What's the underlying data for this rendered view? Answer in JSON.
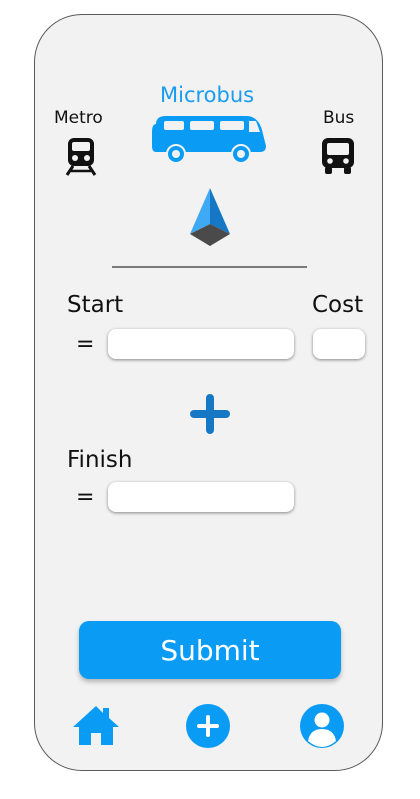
{
  "modes": {
    "metro_label": "Metro",
    "microbus_label": "Microbus",
    "bus_label": "Bus",
    "selected": "Microbus"
  },
  "form": {
    "start_label": "Start",
    "start_eq": "=",
    "start_value": "",
    "cost_label": "Cost",
    "cost_value": "",
    "add_stop_icon": "plus-icon",
    "finish_label": "Finish",
    "finish_eq": "=",
    "finish_value": ""
  },
  "submit_label": "Submit",
  "bottom_nav": [
    "home-icon",
    "add-circle-icon",
    "profile-icon"
  ],
  "colors": {
    "accent": "#0a9cf5",
    "dark_accent": "#1677c4",
    "background": "#f2f2f2"
  }
}
